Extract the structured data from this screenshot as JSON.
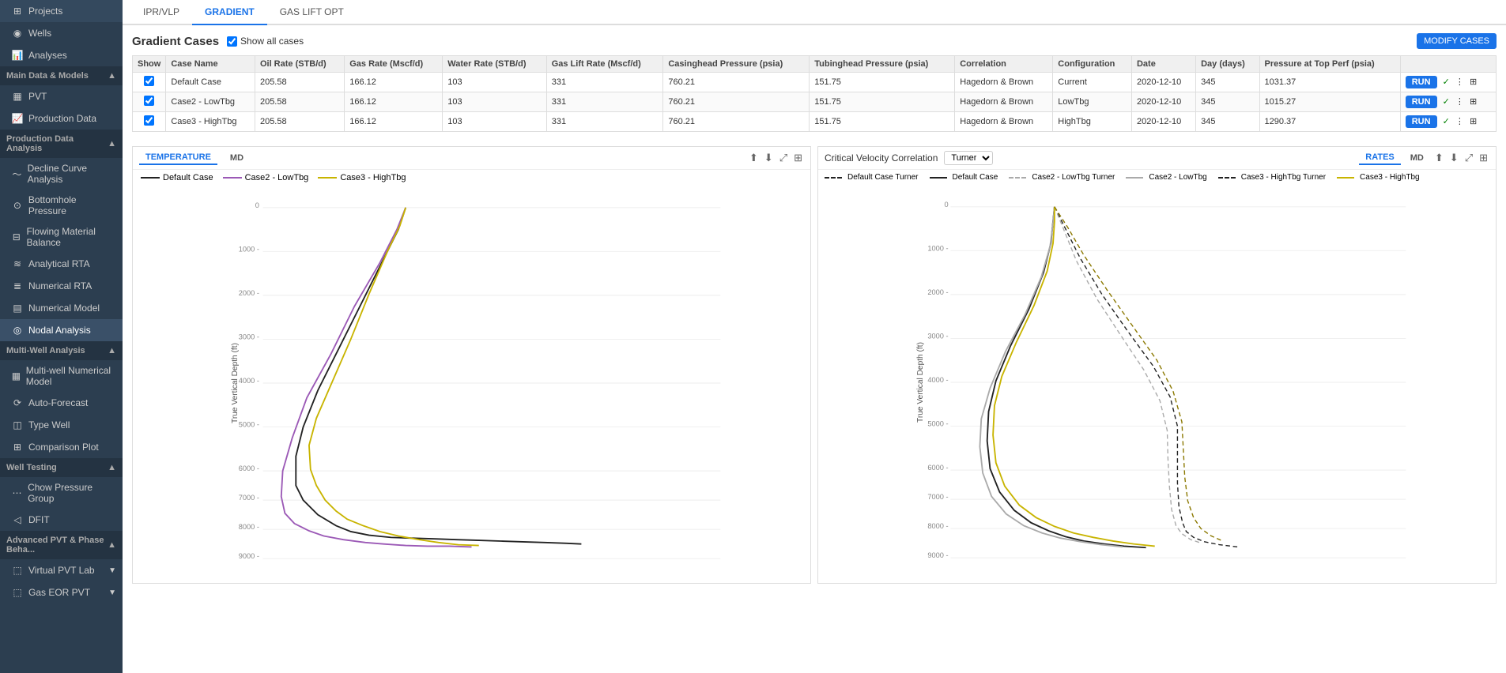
{
  "sidebar": {
    "sections": [
      {
        "label": "Main Data & Models",
        "collapsible": true,
        "items": [
          {
            "id": "pvt",
            "label": "PVT",
            "icon": "table-icon"
          },
          {
            "id": "production-data",
            "label": "Production Data",
            "icon": "chart-icon"
          }
        ]
      },
      {
        "label": "Production Data Analysis",
        "collapsible": true,
        "items": [
          {
            "id": "decline-curve",
            "label": "Decline Curve Analysis",
            "icon": "line-icon"
          },
          {
            "id": "bottomhole",
            "label": "Bottomhole Pressure",
            "icon": "gauge-icon"
          },
          {
            "id": "flowing-material",
            "label": "Flowing Material Balance",
            "icon": "balance-icon"
          },
          {
            "id": "analytical-rta",
            "label": "Analytical RTA",
            "icon": "rta-icon"
          },
          {
            "id": "numerical-rta",
            "label": "Numerical RTA",
            "icon": "num-rta-icon"
          },
          {
            "id": "numerical-model",
            "label": "Numerical Model",
            "icon": "model-icon"
          },
          {
            "id": "nodal-analysis",
            "label": "Nodal Analysis",
            "icon": "nodal-icon"
          }
        ]
      },
      {
        "label": "Multi-Well Analysis",
        "collapsible": true,
        "items": [
          {
            "id": "multiwell-numerical",
            "label": "Multi-well Numerical Model",
            "icon": "multiwell-icon"
          },
          {
            "id": "auto-forecast",
            "label": "Auto-Forecast",
            "icon": "forecast-icon"
          },
          {
            "id": "type-well",
            "label": "Type Well",
            "icon": "typewell-icon"
          },
          {
            "id": "comparison-plot",
            "label": "Comparison Plot",
            "icon": "compare-icon"
          }
        ]
      },
      {
        "label": "Well Testing",
        "collapsible": true,
        "items": [
          {
            "id": "chow-pressure",
            "label": "Chow Pressure Group",
            "icon": "chow-icon"
          },
          {
            "id": "dfit",
            "label": "DFIT",
            "icon": "dfit-icon"
          }
        ]
      },
      {
        "label": "Advanced PVT & Phase Beha...",
        "collapsible": true,
        "items": [
          {
            "id": "virtual-pvt",
            "label": "Virtual PVT Lab",
            "icon": "pvt-lab-icon"
          },
          {
            "id": "gas-eor",
            "label": "Gas EOR PVT",
            "icon": "gas-eor-icon"
          }
        ]
      }
    ],
    "top_items": [
      {
        "id": "projects",
        "label": "Projects",
        "icon": "projects-icon"
      },
      {
        "id": "wells",
        "label": "Wells",
        "icon": "wells-icon"
      },
      {
        "id": "analyses",
        "label": "Analyses",
        "icon": "analyses-icon"
      }
    ]
  },
  "tabs": [
    {
      "id": "ipr-vlp",
      "label": "IPR/VLP"
    },
    {
      "id": "gradient",
      "label": "GRADIENT",
      "active": true
    },
    {
      "id": "gas-lift-opt",
      "label": "GAS LIFT OPT"
    }
  ],
  "gradient_cases": {
    "title": "Gradient Cases",
    "show_all_label": "Show all cases",
    "show_all_checked": true,
    "modify_cases_label": "MODIFY CASES",
    "table": {
      "columns": [
        "Show",
        "Case Name",
        "Oil Rate (STB/d)",
        "Gas Rate (Mscf/d)",
        "Water Rate (STB/d)",
        "Gas Lift Rate (Mscf/d)",
        "Casinghead Pressure (psia)",
        "Tubinghead Pressure (psia)",
        "Correlation",
        "Configuration",
        "Date",
        "Day (days)",
        "Pressure at Top Perf (psia)"
      ],
      "rows": [
        {
          "show": true,
          "case_name": "Default Case",
          "oil_rate": "205.58",
          "gas_rate": "166.12",
          "water_rate": "103",
          "gas_lift_rate": "331",
          "casinghead_pressure": "760.21",
          "tubinghead_pressure": "151.75",
          "correlation": "Hagedorn & Brown",
          "configuration": "Current",
          "date": "2020-12-10",
          "day": "345",
          "pressure_top_perf": "1031.37"
        },
        {
          "show": true,
          "case_name": "Case2 - LowTbg",
          "oil_rate": "205.58",
          "gas_rate": "166.12",
          "water_rate": "103",
          "gas_lift_rate": "331",
          "casinghead_pressure": "760.21",
          "tubinghead_pressure": "151.75",
          "correlation": "Hagedorn & Brown",
          "configuration": "LowTbg",
          "date": "2020-12-10",
          "day": "345",
          "pressure_top_perf": "1015.27"
        },
        {
          "show": true,
          "case_name": "Case3 - HighTbg",
          "oil_rate": "205.58",
          "gas_rate": "166.12",
          "water_rate": "103",
          "gas_lift_rate": "331",
          "casinghead_pressure": "760.21",
          "tubinghead_pressure": "151.75",
          "correlation": "Hagedorn & Brown",
          "configuration": "HighTbg",
          "date": "2020-12-10",
          "day": "345",
          "pressure_top_perf": "1290.37"
        }
      ]
    }
  },
  "left_chart": {
    "toolbar_tabs": [
      "TEMPERATURE",
      "MD"
    ],
    "active_tab": "TEMPERATURE",
    "legend": [
      {
        "label": "Default Case",
        "color": "#222222",
        "style": "solid"
      },
      {
        "label": "Case2 - LowTbg",
        "color": "#9b59b6",
        "style": "solid"
      },
      {
        "label": "Case3 - HighTbg",
        "color": "#c8b400",
        "style": "solid"
      }
    ],
    "y_axis_label": "True Vertical Depth (ft)",
    "y_values": [
      "0",
      "1000",
      "2000",
      "3000",
      "4000",
      "5000",
      "6000",
      "7000",
      "8000",
      "9000"
    ]
  },
  "right_chart": {
    "title": "Critical Velocity Correlation",
    "dropdown_options": [
      "Turner"
    ],
    "selected_option": "Turner",
    "toolbar_tabs": [
      "RATES",
      "MD"
    ],
    "active_tab": "RATES",
    "legend": [
      {
        "label": "Default Case Turner",
        "color": "#222222",
        "style": "dashed"
      },
      {
        "label": "Default Case",
        "color": "#222222",
        "style": "solid"
      },
      {
        "label": "Case2 - LowTbg Turner",
        "color": "#aaaaaa",
        "style": "dashed"
      },
      {
        "label": "Case2 - LowTbg",
        "color": "#aaaaaa",
        "style": "solid"
      },
      {
        "label": "Case3 - HighTbg Turner",
        "color": "#222222",
        "style": "dashed"
      },
      {
        "label": "Case3 - HighTbg",
        "color": "#c8b400",
        "style": "solid"
      }
    ],
    "y_axis_label": "True Vertical Depth (ft)",
    "y_values": [
      "0",
      "1000",
      "2000",
      "3000",
      "4000",
      "5000",
      "6000",
      "7000",
      "8000",
      "9000"
    ]
  }
}
